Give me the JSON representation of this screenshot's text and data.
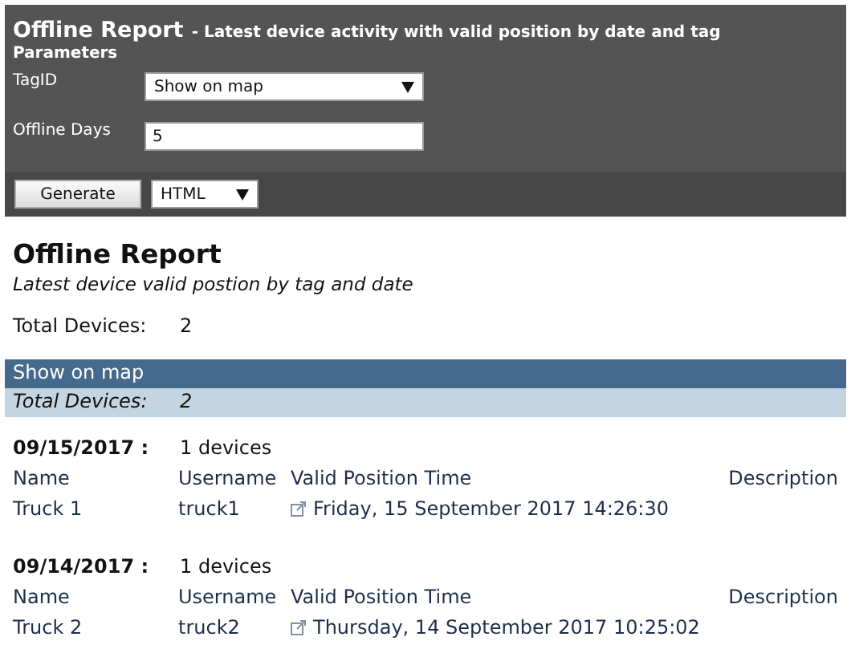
{
  "header": {
    "title": "Offline Report",
    "subtitle": "- Latest device activity with valid position by date and tag",
    "section": "Parameters"
  },
  "parameters": [
    {
      "kind": "select",
      "label": "TagID",
      "value": "Show on map"
    },
    {
      "kind": "text",
      "label": "Offline Days",
      "value": "5"
    }
  ],
  "actions": {
    "button": "Generate",
    "format": "HTML"
  },
  "report": {
    "title": "Offline Report",
    "subtitle": "Latest device valid postion by tag and date",
    "total_label": "Total Devices:",
    "total_value": "2"
  },
  "tag_group": {
    "name": "Show on map",
    "total_label": "Total Devices:",
    "total_value": "2"
  },
  "dates": [
    {
      "date": "09/15/2017 :",
      "count": "1 devices",
      "columns": [
        "Name",
        "Username",
        "Valid Position Time",
        "Description"
      ],
      "rows": [
        {
          "name": "Truck 1",
          "username": "truck1",
          "time": "Friday, 15 September 2017 14:26:30"
        }
      ]
    },
    {
      "date": "09/14/2017 :",
      "count": "1 devices",
      "columns": [
        "Name",
        "Username",
        "Valid Position Time",
        "Description"
      ],
      "rows": [
        {
          "name": "Truck 2",
          "username": "truck2",
          "time": "Thursday, 14 September 2017 10:25:02"
        }
      ]
    }
  ]
}
